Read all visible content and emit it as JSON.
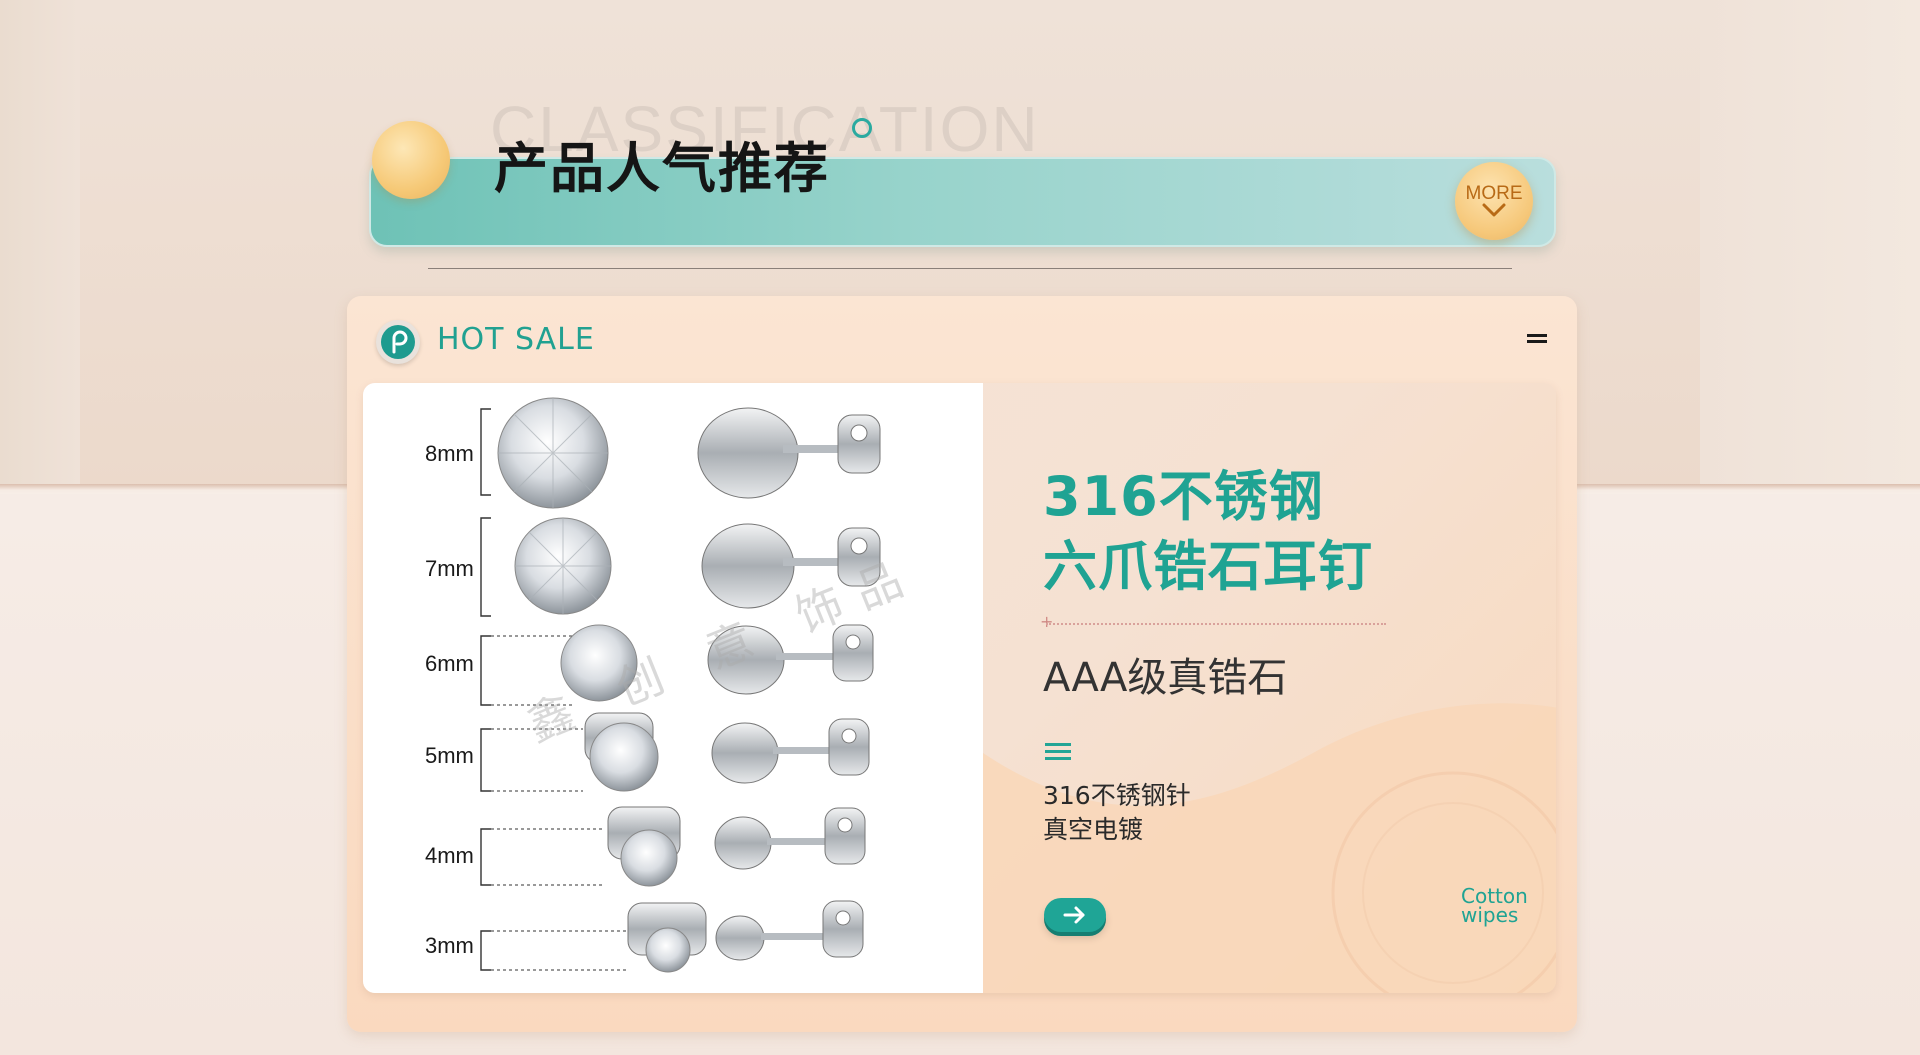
{
  "header": {
    "ghost_text": "CLASSIFICATION",
    "title": "产品人气推荐",
    "more_label": "MORE"
  },
  "card": {
    "badge_text": "HOT SALE",
    "sizes": [
      "8mm",
      "7mm",
      "6mm",
      "5mm",
      "4mm",
      "3mm"
    ],
    "watermark": "鑫 创 意 饰品",
    "headline_line1": "316不锈钢",
    "headline_line2": "六爪锆石耳钉",
    "grade": "AAA级真锆石",
    "feature1": "316不锈钢针",
    "feature2": "真空电镀",
    "corner_line1": "Cotton",
    "corner_line2": "wipes"
  },
  "colors": {
    "accent": "#1fa393",
    "title_bar": "#8fd0c7",
    "more_button": "#f6c87a",
    "card": "#fad9bf"
  },
  "icons": {
    "badge": "p-logo-icon",
    "menu": "menu-icon",
    "list": "list-icon",
    "arrow": "arrow-right-icon",
    "more": "chevron-down-icon"
  }
}
